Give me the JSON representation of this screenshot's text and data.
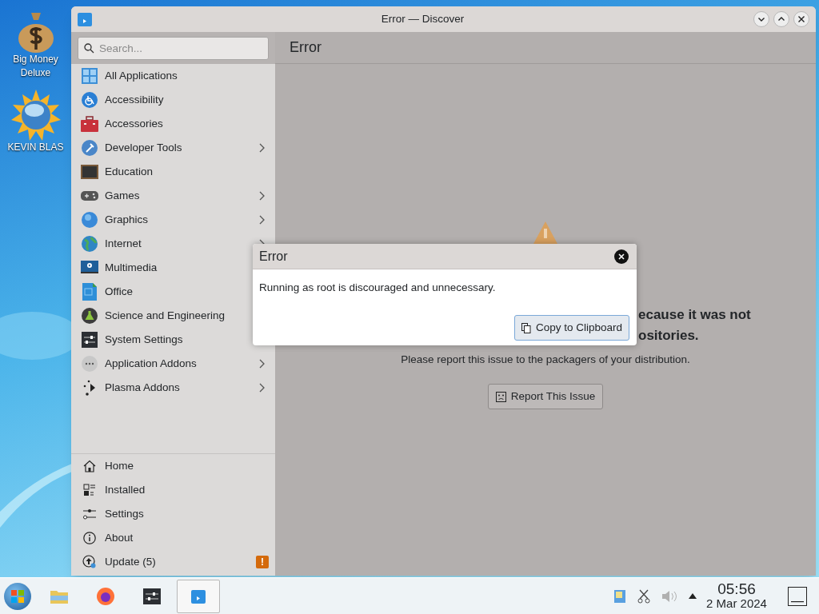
{
  "desktop_icons": [
    {
      "label": "Big Money Deluxe"
    },
    {
      "label": "KEVIN BLAS"
    }
  ],
  "window": {
    "title": "Error — Discover"
  },
  "sidebar": {
    "search": {
      "placeholder": "Search..."
    },
    "categories": [
      {
        "label": "All Applications",
        "has_children": false
      },
      {
        "label": "Accessibility",
        "has_children": false
      },
      {
        "label": "Accessories",
        "has_children": false
      },
      {
        "label": "Developer Tools",
        "has_children": true
      },
      {
        "label": "Education",
        "has_children": false
      },
      {
        "label": "Games",
        "has_children": true
      },
      {
        "label": "Graphics",
        "has_children": true
      },
      {
        "label": "Internet",
        "has_children": true
      },
      {
        "label": "Multimedia",
        "has_children": false
      },
      {
        "label": "Office",
        "has_children": false
      },
      {
        "label": "Science and Engineering",
        "has_children": false
      },
      {
        "label": "System Settings",
        "has_children": false
      },
      {
        "label": "Application Addons",
        "has_children": true
      },
      {
        "label": "Plasma Addons",
        "has_children": true
      }
    ],
    "nav": [
      {
        "label": "Home"
      },
      {
        "label": "Installed"
      },
      {
        "label": "Settings"
      },
      {
        "label": "About"
      },
      {
        "label": "Update (5)",
        "badge": "!"
      }
    ]
  },
  "page": {
    "title": "Error",
    "message_lines": [
      "ecause it was not",
      "ositories."
    ],
    "hint": "Please report this issue to the packagers of your distribution.",
    "button": "Report This Issue"
  },
  "dialog": {
    "title": "Error",
    "message": "Running as root is discouraged and unnecessary.",
    "button": "Copy to Clipboard"
  },
  "taskbar": {
    "time": "05:56",
    "date": "2 Mar 2024"
  }
}
